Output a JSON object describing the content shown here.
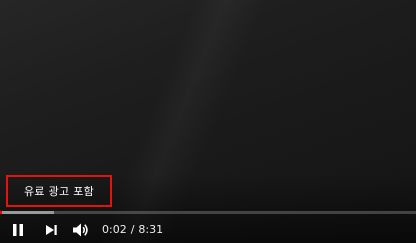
{
  "overlay": {
    "paid_promotion_label": "유료 광고 포함",
    "highlight_color": "#e3140f"
  },
  "player": {
    "state": "paused",
    "current_time": "0:02",
    "time_separator": "/",
    "duration": "8:31",
    "played_fraction": 0.004,
    "loaded_fraction": 0.13,
    "progress_color": "#ff0000",
    "controls": {
      "play_pause_icon": "pause-icon",
      "next_icon": "next-track-icon",
      "volume_icon": "volume-icon"
    }
  }
}
